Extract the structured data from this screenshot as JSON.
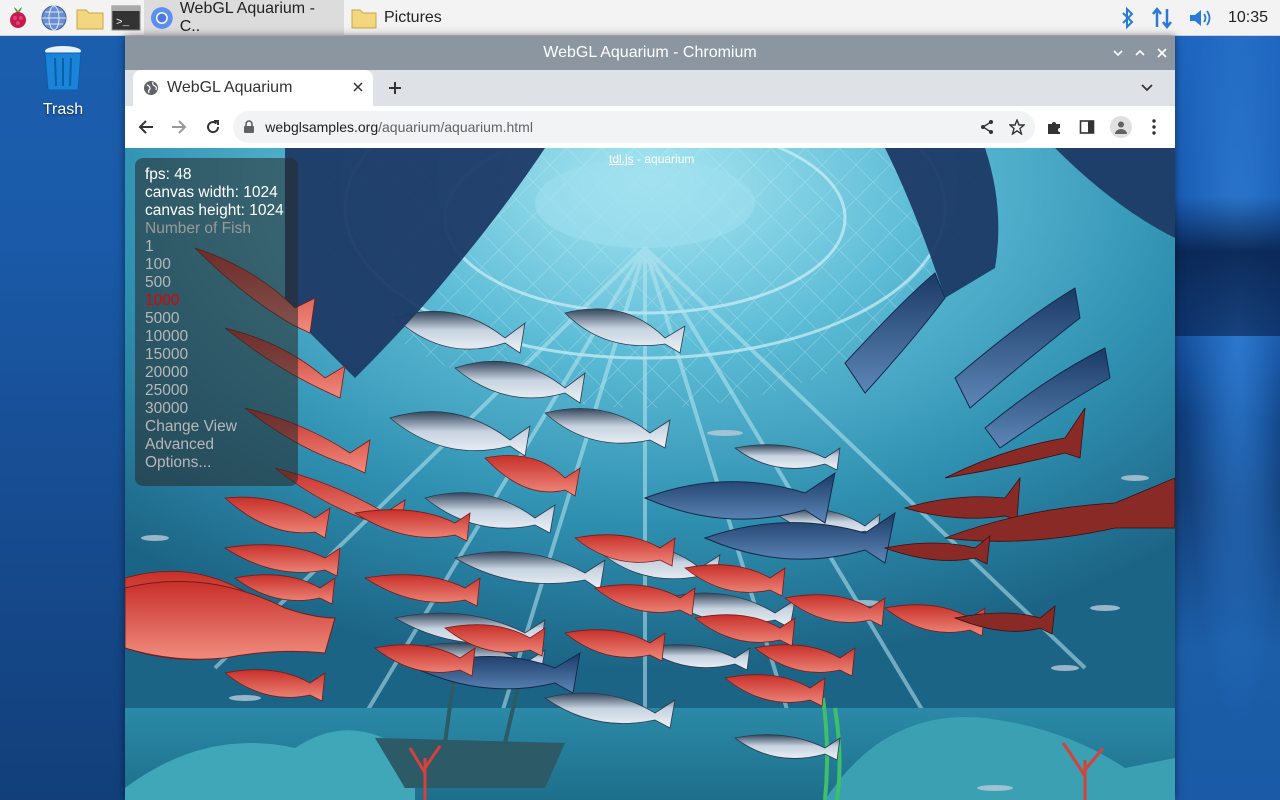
{
  "taskbar": {
    "tasks": [
      {
        "label": "WebGL Aquarium - C.."
      },
      {
        "label": "Pictures"
      }
    ],
    "clock": "10:35"
  },
  "desktop": {
    "trash_label": "Trash"
  },
  "window": {
    "title": "WebGL Aquarium - Chromium",
    "tab_title": "WebGL Aquarium",
    "url_host": "webglsamples.org",
    "url_path": "/aquarium/aquarium.html"
  },
  "page": {
    "credit_link": "tdl.js",
    "credit_text": " - aquarium",
    "fps": "fps: 48",
    "canvas_width": "canvas width: 1024",
    "canvas_height": "canvas height: 1024",
    "fish_header": "Number of Fish",
    "fish_options": [
      "1",
      "100",
      "500",
      "1000",
      "5000",
      "10000",
      "15000",
      "20000",
      "25000",
      "30000"
    ],
    "selected_fish": "1000",
    "change_view": "Change View",
    "advanced": "Advanced",
    "options": "Options..."
  },
  "colors": {
    "selected": "#e30000",
    "water": "#2f8fb0",
    "red_fish": "#d8453a",
    "tuna": "#c7d3e0"
  }
}
